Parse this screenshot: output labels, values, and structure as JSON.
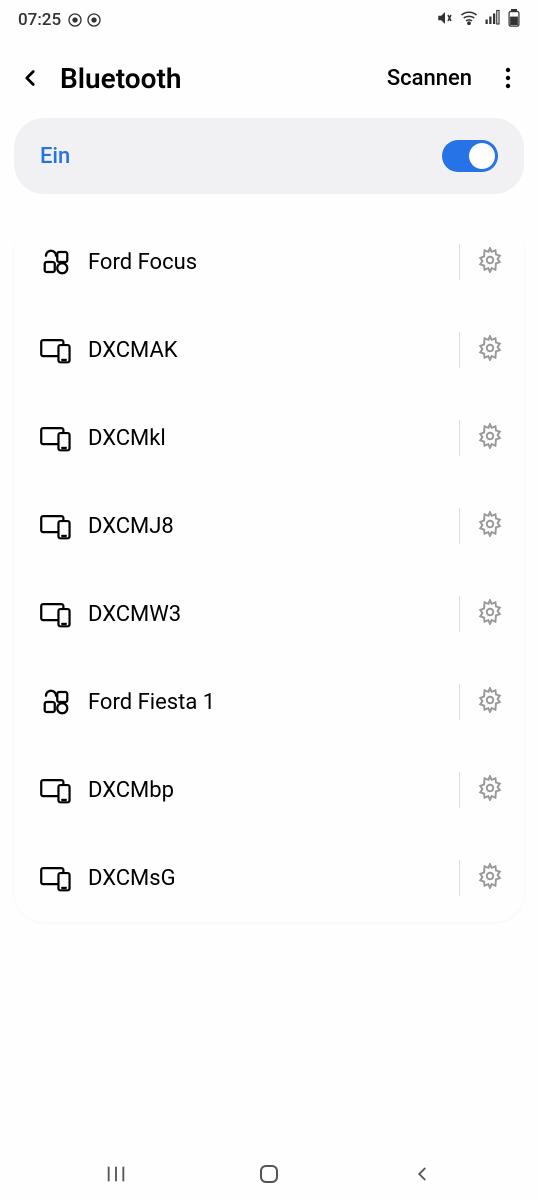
{
  "status": {
    "time": "07:25"
  },
  "header": {
    "title": "Bluetooth",
    "scan_label": "Scannen"
  },
  "toggle": {
    "label": "Ein",
    "enabled": true
  },
  "devices": [
    {
      "name": "Ford Focus",
      "icon": "kit"
    },
    {
      "name": "DXCMAK",
      "icon": "devices"
    },
    {
      "name": "DXCMkl",
      "icon": "devices"
    },
    {
      "name": "DXCMJ8",
      "icon": "devices"
    },
    {
      "name": "DXCMW3",
      "icon": "devices"
    },
    {
      "name": "Ford Fiesta 1",
      "icon": "kit"
    },
    {
      "name": "DXCMbp",
      "icon": "devices"
    },
    {
      "name": "DXCMsG",
      "icon": "devices"
    }
  ]
}
